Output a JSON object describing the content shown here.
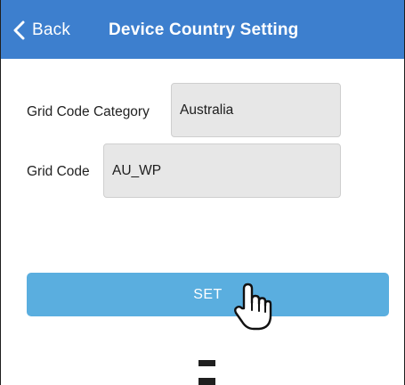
{
  "nav": {
    "back_label": "Back",
    "title": "Device Country Setting"
  },
  "form": {
    "category_label": "Grid Code Category",
    "category_value": "Australia",
    "code_label": "Grid Code",
    "code_value": "AU_WP"
  },
  "actions": {
    "set_label": "SET"
  },
  "icons": {
    "back": "chevron-left-icon",
    "pointer": "hand-pointer-icon"
  },
  "colors": {
    "nav_bar": "#3d7fce",
    "set_button": "#5aaedf",
    "field_bg": "#e7e7e7"
  }
}
